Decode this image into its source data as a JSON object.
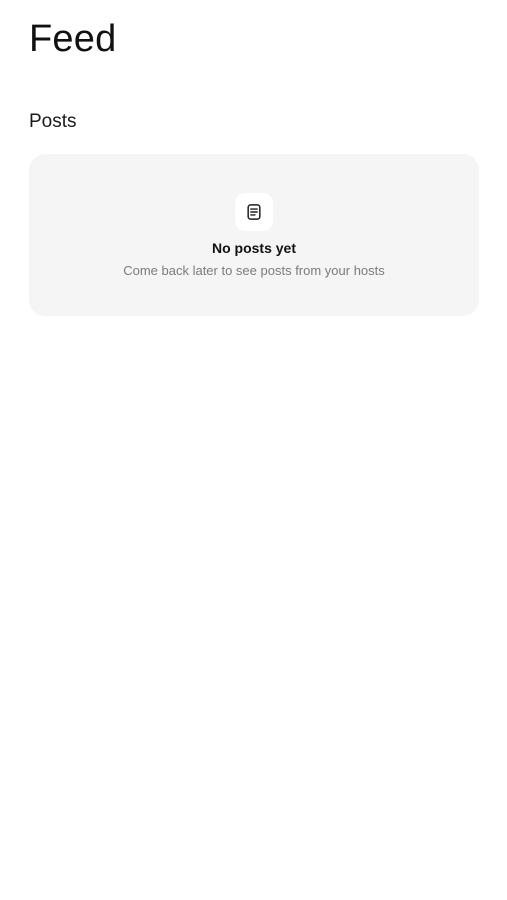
{
  "header": {
    "title": "Feed"
  },
  "posts": {
    "section_title": "Posts",
    "empty_state": {
      "icon": "document-icon",
      "title": "No posts yet",
      "subtitle": "Come back later to see posts from your hosts"
    }
  },
  "colors": {
    "background": "#ffffff",
    "card_background": "#f5f5f5",
    "primary_text": "#111111",
    "secondary_text": "#7b7b7b"
  }
}
